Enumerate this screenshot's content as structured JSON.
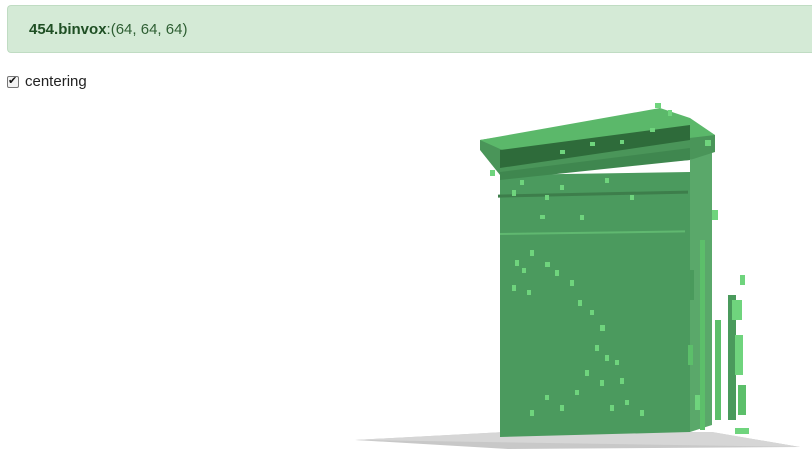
{
  "header": {
    "filename": "454.binvox",
    "separator": ": ",
    "dimensions": "(64, 64, 64)"
  },
  "controls": {
    "centering_label": "centering",
    "centering_checked": true
  },
  "viewer": {
    "voxel_color": "#4a9a5c",
    "voxel_top_color": "#5cbf6a",
    "voxel_highlight_color": "#6fd47d",
    "ground_color": "#c8c8c8"
  }
}
